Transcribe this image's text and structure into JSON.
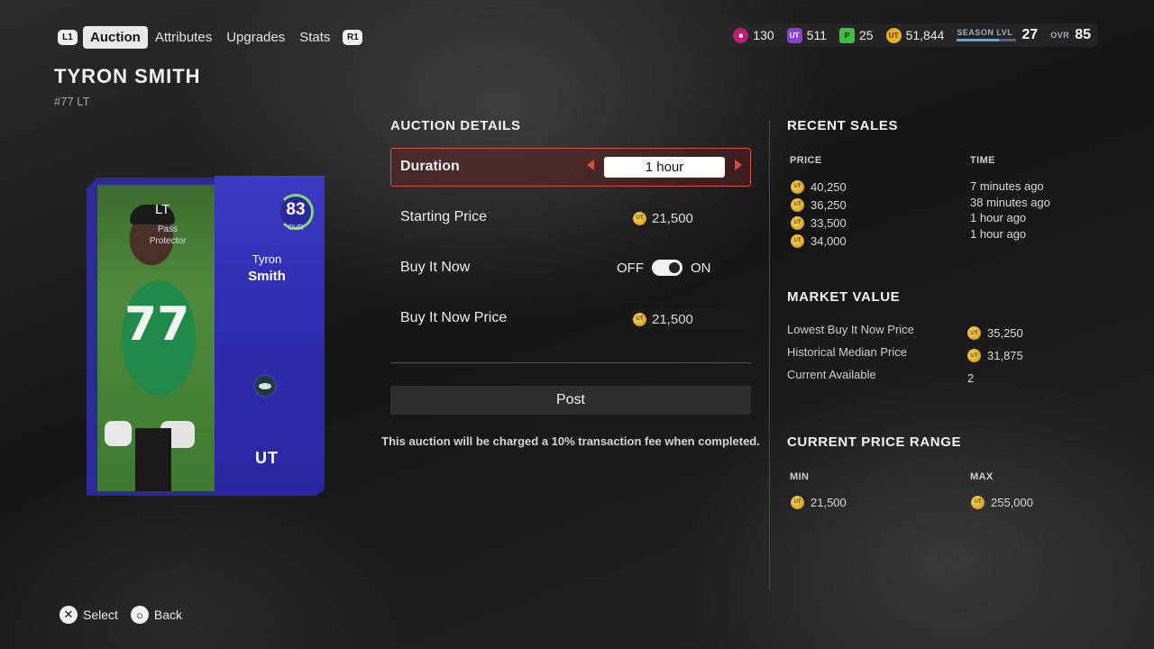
{
  "nav": {
    "left_bumper": "L1",
    "right_bumper": "R1",
    "tabs": [
      "Auction",
      "Attributes",
      "Upgrades",
      "Stats"
    ],
    "active_tab": "Auction"
  },
  "currencies": [
    {
      "icon": "training-points-icon",
      "value": "130",
      "color": "#c2187a"
    },
    {
      "icon": "ut-points-icon",
      "value": "511",
      "color": "#8b3fd6"
    },
    {
      "icon": "p-points-icon",
      "value": "25",
      "color": "#3fbf3f"
    },
    {
      "icon": "coins-icon",
      "value": "51,844",
      "color": "#e8b020"
    }
  ],
  "season": {
    "label": "SEASON LVL",
    "level": "27",
    "ovr_label": "OVR",
    "ovr": "85"
  },
  "player": {
    "name": "TYRON SMITH",
    "sub": "#77 LT"
  },
  "card": {
    "position": "LT",
    "archetype_line1": "Pass",
    "archetype_line2": "Protector",
    "ovr": "83",
    "ovr_label": "OVR",
    "first_name": "Tyron",
    "last_name": "Smith",
    "jersey": "77",
    "brand": "UT",
    "color": "#2f2db1"
  },
  "auction": {
    "title": "AUCTION DETAILS",
    "duration_label": "Duration",
    "duration_value": "1 hour",
    "starting_price_label": "Starting Price",
    "starting_price": "21,500",
    "buy_it_now_label": "Buy It Now",
    "toggle_off": "OFF",
    "toggle_on": "ON",
    "buy_it_now_state": "on",
    "buy_it_now_price_label": "Buy It Now Price",
    "buy_it_now_price": "21,500",
    "post_label": "Post",
    "fee_note": "This auction will be charged a 10% transaction fee when completed."
  },
  "recent_sales": {
    "title": "RECENT SALES",
    "price_header": "PRICE",
    "time_header": "TIME",
    "rows": [
      {
        "price": "40,250",
        "time": "7 minutes ago"
      },
      {
        "price": "36,250",
        "time": "38 minutes ago"
      },
      {
        "price": "33,500",
        "time": "1 hour ago"
      },
      {
        "price": "34,000",
        "time": "1 hour ago"
      }
    ]
  },
  "market_value": {
    "title": "MARKET VALUE",
    "rows": [
      {
        "label": "Lowest Buy It Now Price",
        "value": "35,250",
        "coin": true
      },
      {
        "label": "Historical Median Price",
        "value": "31,875",
        "coin": true
      },
      {
        "label": "Current Available",
        "value": "2",
        "coin": false
      }
    ]
  },
  "price_range": {
    "title": "CURRENT PRICE RANGE",
    "min_header": "MIN",
    "max_header": "MAX",
    "min": "21,500",
    "max": "255,000"
  },
  "footer": {
    "select_glyph": "✕",
    "select_label": "Select",
    "back_glyph": "○",
    "back_label": "Back"
  }
}
